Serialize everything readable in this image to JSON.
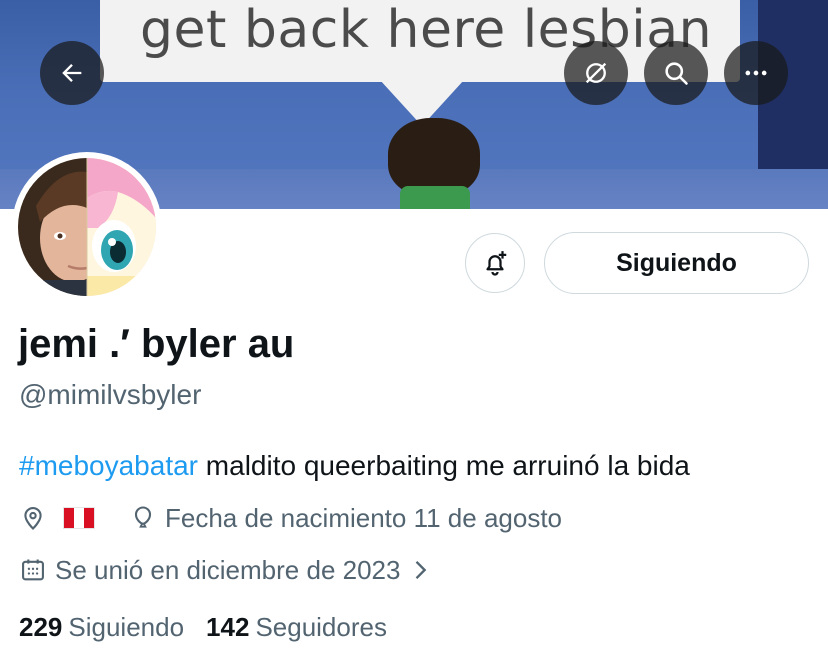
{
  "header": {
    "banner_text": "get back here lesbian",
    "back_icon": "arrow-left-icon",
    "hide_icon": "eye-slash-icon",
    "search_icon": "search-icon",
    "more_icon": "more-horizontal-icon"
  },
  "profile": {
    "name": "jemi .′ byler au",
    "handle": "@mimilvsbyler",
    "bio_hashtag": "#meboyabatar",
    "bio_text": " maldito queerbaiting me arruinó la bida",
    "location_flag": "Peru",
    "birthday": "Fecha de nacimiento 11 de agosto",
    "joined": "Se unió en diciembre de 2023"
  },
  "actions": {
    "notify_icon": "bell-plus-icon",
    "follow_label": "Siguiendo"
  },
  "stats": {
    "following_count": "229",
    "following_label": "Siguiendo",
    "followers_count": "142",
    "followers_label": "Seguidores"
  },
  "colors": {
    "link": "#1d9bf0",
    "secondary_text": "#536471",
    "primary_text": "#0f1419"
  }
}
